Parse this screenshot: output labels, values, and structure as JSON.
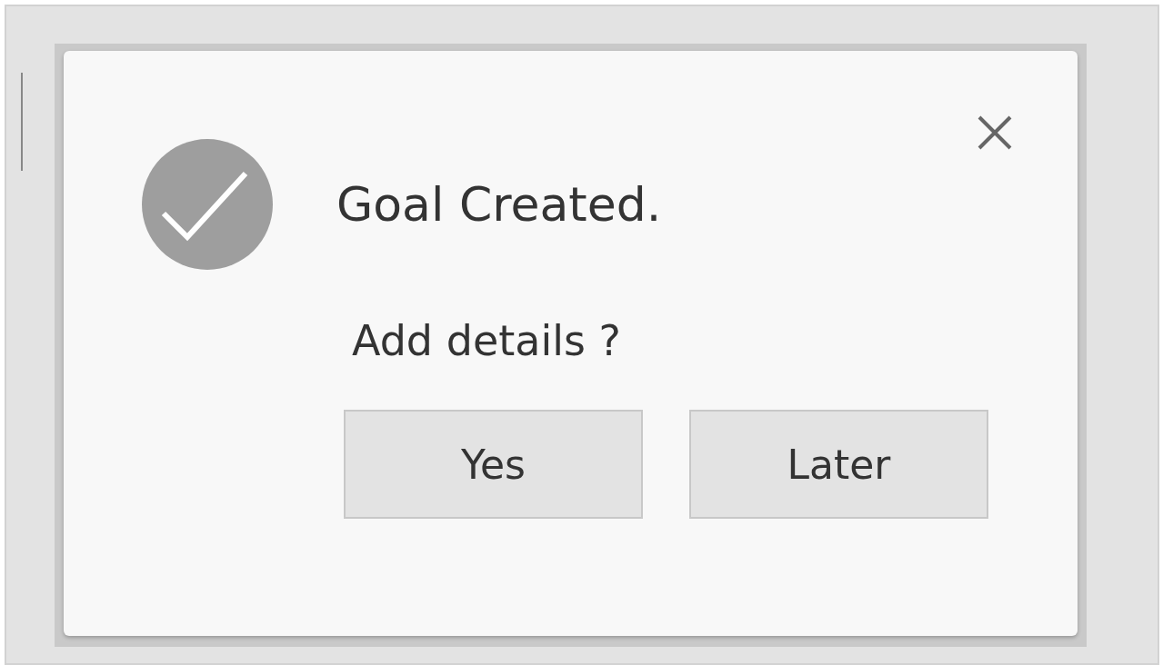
{
  "dialog": {
    "title": "Goal Created.",
    "message": "Add details ?",
    "buttons": [
      {
        "label": "Yes"
      },
      {
        "label": "Later"
      }
    ]
  }
}
